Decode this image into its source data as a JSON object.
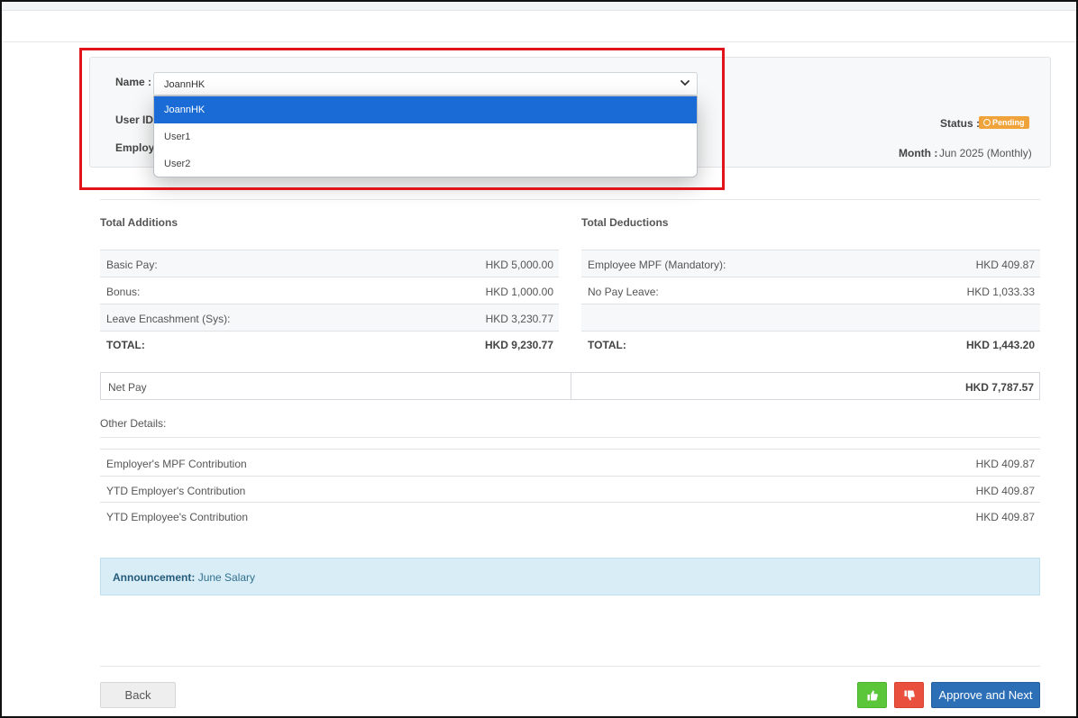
{
  "header": {
    "name_label": "Name :",
    "name_selected": "JoannHK",
    "name_options": [
      "JoannHK",
      "User1",
      "User2"
    ],
    "user_id_label": "User ID",
    "employee_label": "Employe",
    "status_label": "Status :",
    "status_value": "Pending",
    "month_label": "Month :",
    "month_value": "Jun 2025 (Monthly)"
  },
  "additions": {
    "title": "Total Additions",
    "rows": [
      {
        "label": "Basic Pay:",
        "value": "HKD 5,000.00"
      },
      {
        "label": "Bonus:",
        "value": "HKD 1,000.00"
      },
      {
        "label": "Leave Encashment (Sys):",
        "value": "HKD 3,230.77"
      }
    ],
    "total_label": "TOTAL:",
    "total_value": "HKD 9,230.77"
  },
  "deductions": {
    "title": "Total Deductions",
    "rows": [
      {
        "label": "Employee MPF (Mandatory):",
        "value": "HKD 409.87"
      },
      {
        "label": "No Pay Leave:",
        "value": "HKD 1,033.33"
      },
      {
        "label": "",
        "value": ""
      }
    ],
    "total_label": "TOTAL:",
    "total_value": "HKD 1,443.20"
  },
  "net_pay": {
    "label": "Net Pay",
    "value": "HKD 7,787.57"
  },
  "other_details": {
    "title": "Other Details:",
    "rows": [
      {
        "label": "Employer's MPF Contribution",
        "value": "HKD 409.87"
      },
      {
        "label": "YTD Employer's Contribution",
        "value": "HKD 409.87"
      },
      {
        "label": "YTD Employee's Contribution",
        "value": "HKD 409.87"
      }
    ]
  },
  "announcement": {
    "label": "Announcement:",
    "text": "June Salary"
  },
  "footer": {
    "back_label": "Back",
    "approve_label": "Approve and Next"
  },
  "colors": {
    "selected_option": "#1a6bd5",
    "pending_badge": "#f0a33a",
    "approve_button": "#2c6fb7",
    "thumbs_up_button": "#5cc63b",
    "thumbs_down_button": "#e9503d",
    "highlight_border": "#e0141b"
  },
  "icons": {
    "dropdown": "chevron-down-icon",
    "status": "clock-icon",
    "approve": "thumbs-up-icon",
    "reject": "thumbs-down-icon"
  }
}
